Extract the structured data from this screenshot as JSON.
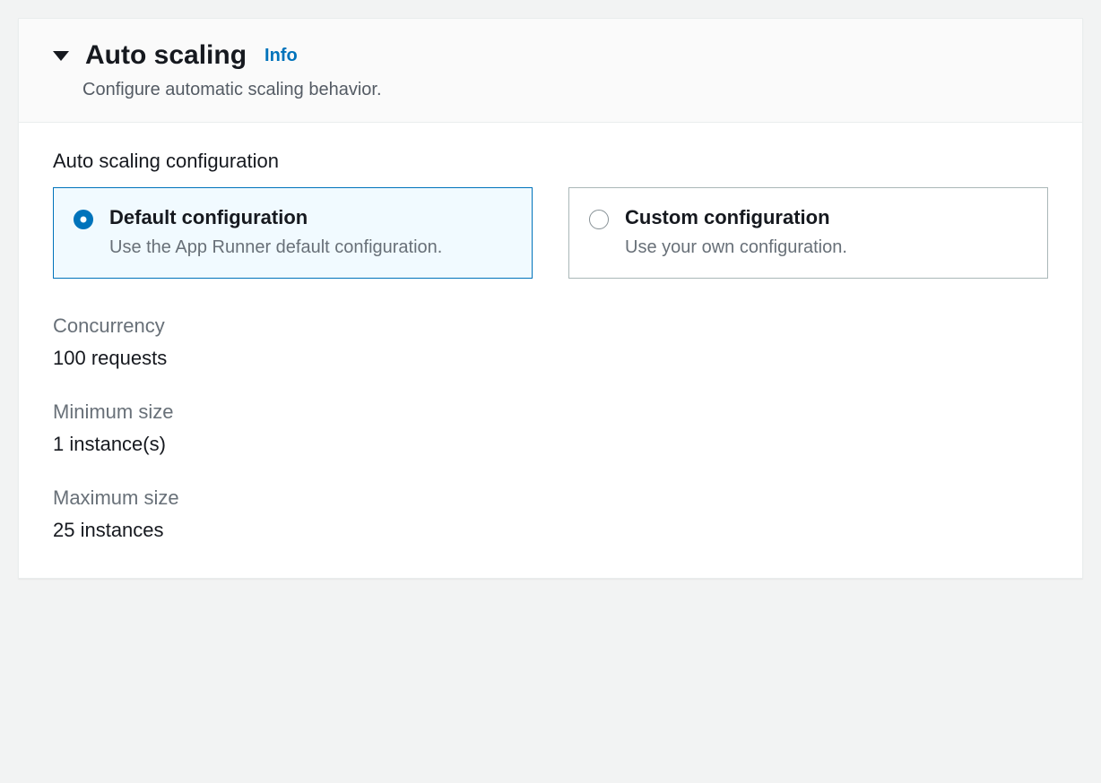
{
  "header": {
    "title": "Auto scaling",
    "infoLabel": "Info",
    "subtitle": "Configure automatic scaling behavior."
  },
  "configSection": {
    "label": "Auto scaling configuration",
    "options": [
      {
        "title": "Default configuration",
        "description": "Use the App Runner default configuration.",
        "selected": true
      },
      {
        "title": "Custom configuration",
        "description": "Use your own configuration.",
        "selected": false
      }
    ]
  },
  "fields": [
    {
      "label": "Concurrency",
      "value": "100 requests"
    },
    {
      "label": "Minimum size",
      "value": "1 instance(s)"
    },
    {
      "label": "Maximum size",
      "value": "25 instances"
    }
  ]
}
